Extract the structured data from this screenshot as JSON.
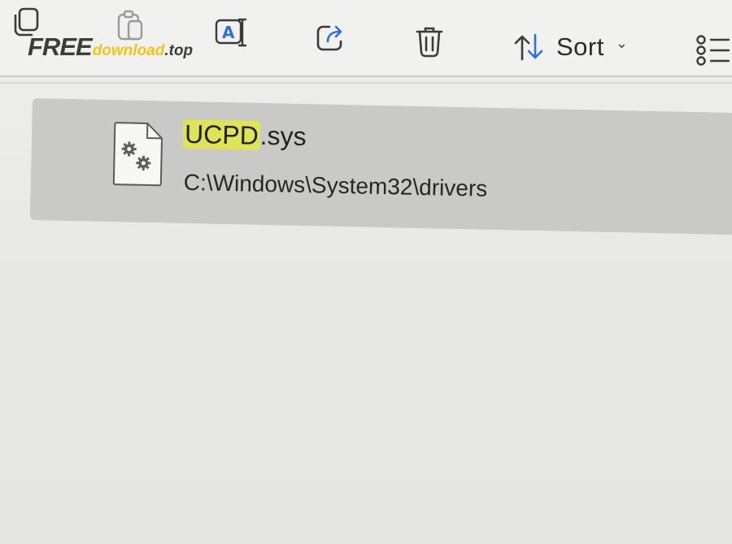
{
  "toolbar": {
    "buttons": [
      {
        "name": "copy",
        "icon": "copy-icon"
      },
      {
        "name": "paste",
        "icon": "paste-icon"
      },
      {
        "name": "rename",
        "icon": "rename-icon"
      },
      {
        "name": "share",
        "icon": "share-icon"
      },
      {
        "name": "delete",
        "icon": "trash-icon"
      },
      {
        "name": "sort",
        "icon": "sort-arrows-icon"
      },
      {
        "name": "view",
        "icon": "view-list-icon"
      }
    ],
    "sort_label": "Sort",
    "sort_chevron": "⌄"
  },
  "watermark": {
    "free": "FREE",
    "download": "download",
    "top": ".top"
  },
  "result": {
    "icon": "system-file-gear-icon",
    "name_highlight": "UCPD",
    "name_rest": ".sys",
    "path": "C:\\Windows\\System32\\drivers"
  },
  "colors": {
    "highlight": "#dfe35a",
    "selected_row": "#c9c9c7",
    "watermark_accent": "#f0c420"
  }
}
